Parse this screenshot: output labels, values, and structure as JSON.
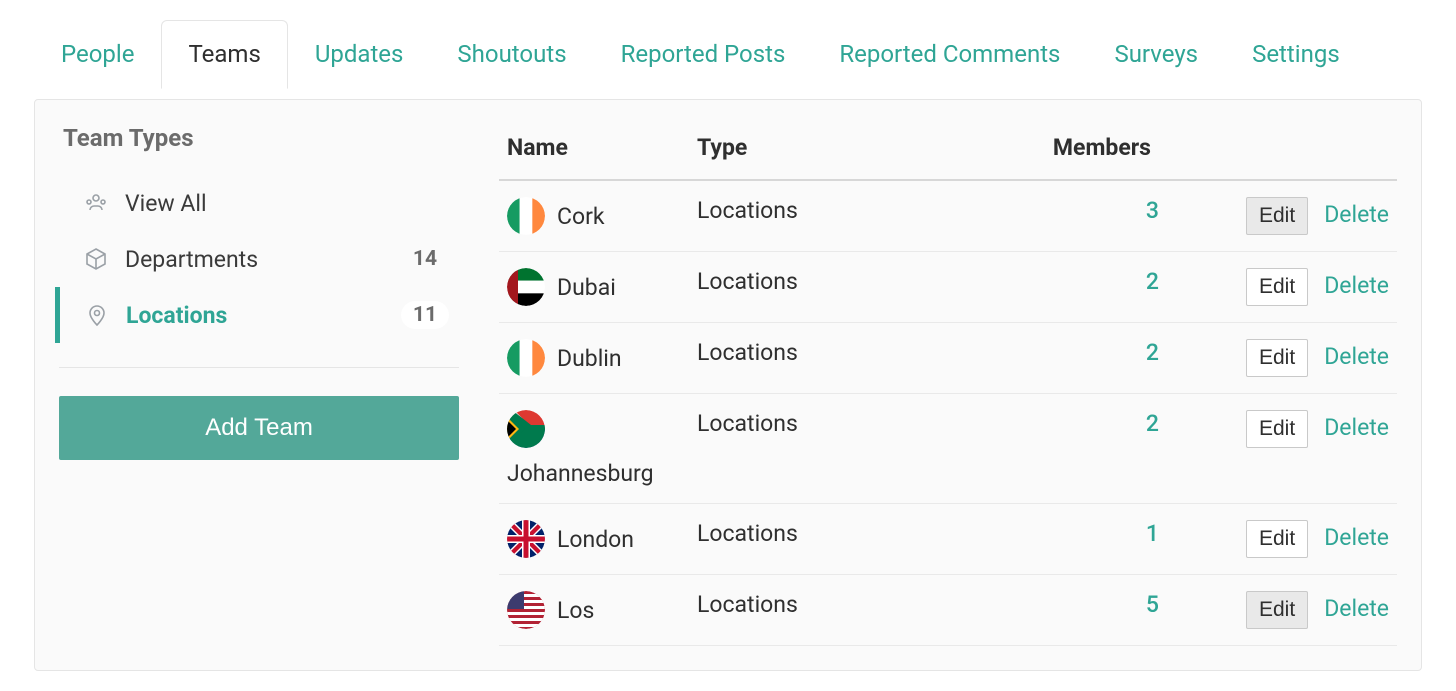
{
  "tabs": [
    {
      "label": "People"
    },
    {
      "label": "Teams",
      "active": true
    },
    {
      "label": "Updates"
    },
    {
      "label": "Shoutouts"
    },
    {
      "label": "Reported Posts"
    },
    {
      "label": "Reported Comments"
    },
    {
      "label": "Surveys"
    },
    {
      "label": "Settings"
    }
  ],
  "sidebar": {
    "title": "Team Types",
    "view_all": "View All",
    "departments": {
      "label": "Departments",
      "count": "14"
    },
    "locations": {
      "label": "Locations",
      "count": "11"
    },
    "add_team": "Add Team"
  },
  "table": {
    "headers": {
      "name": "Name",
      "type": "Type",
      "members": "Members"
    },
    "edit_label": "Edit",
    "delete_label": "Delete",
    "rows": [
      {
        "name": "Cork",
        "type": "Locations",
        "members": "3",
        "flag": "ireland",
        "edit_hover": true
      },
      {
        "name": "Dubai",
        "type": "Locations",
        "members": "2",
        "flag": "uae"
      },
      {
        "name": "Dublin",
        "type": "Locations",
        "members": "2",
        "flag": "ireland"
      },
      {
        "name": "Johannesburg",
        "type": "Locations",
        "members": "2",
        "flag": "south-africa",
        "wrap": true
      },
      {
        "name": "London",
        "type": "Locations",
        "members": "1",
        "flag": "uk"
      },
      {
        "name": "Los",
        "type": "Locations",
        "members": "5",
        "flag": "usa",
        "edit_hover": true
      }
    ]
  }
}
